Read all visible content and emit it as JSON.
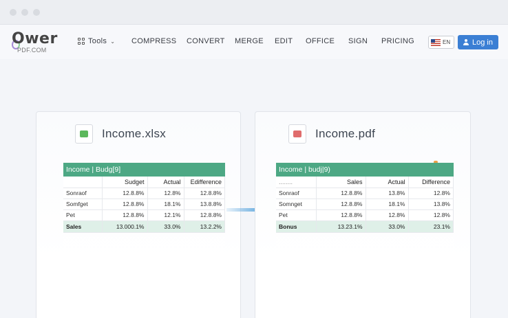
{
  "nav": {
    "logo_main": "Ower",
    "logo_sub": "PDF.COM",
    "tools_label": "Tools",
    "items": [
      "COMPRESS",
      "CONVERT",
      "MERGE",
      "EDIT",
      "OFFICE",
      "SIGN",
      "PRICING"
    ],
    "lang": "EN",
    "login": "Log in"
  },
  "left_file": {
    "name": "Income.xlsx",
    "title": "Income | Budg[9]",
    "headers": [
      "",
      "Sudget",
      "Actual",
      "Edifference"
    ],
    "rows": [
      [
        "Sonraof",
        "12.8.8%",
        "12.8%",
        "12.8.8%"
      ],
      [
        "Somfget",
        "12.8.8%",
        "18.1%",
        "13.8.8%"
      ],
      [
        "Pet",
        "12.8.8%",
        "12.1%",
        "12.8.8%"
      ]
    ],
    "total": [
      "Sales",
      "13.000.1%",
      "33.0%",
      "13.2.2%"
    ]
  },
  "right_file": {
    "name": "Income.pdf",
    "title": "Income | budj|9)",
    "headers": [
      "........",
      "Sales",
      "Actual",
      "Difference"
    ],
    "rows": [
      [
        "Sonraof",
        "12.8.8%",
        "13.8%",
        "12.8%"
      ],
      [
        "Somnget",
        "12.8.8%",
        "18.1%",
        "13.8%"
      ],
      [
        "Pet",
        "12.8.8%",
        "12.8%",
        "12.8%"
      ]
    ],
    "total": [
      "Bonus",
      "13.23.1%",
      "33.0%",
      "23.1%"
    ]
  },
  "colors": {
    "accent": "#3b7fd4",
    "table_header": "#4da884",
    "total_row": "#dff0e8",
    "arrow": "#6aaee0"
  },
  "icons": {
    "xlsx": "spreadsheet-file-icon",
    "pdf": "pdf-file-icon",
    "arrow": "arrow-right-icon"
  }
}
